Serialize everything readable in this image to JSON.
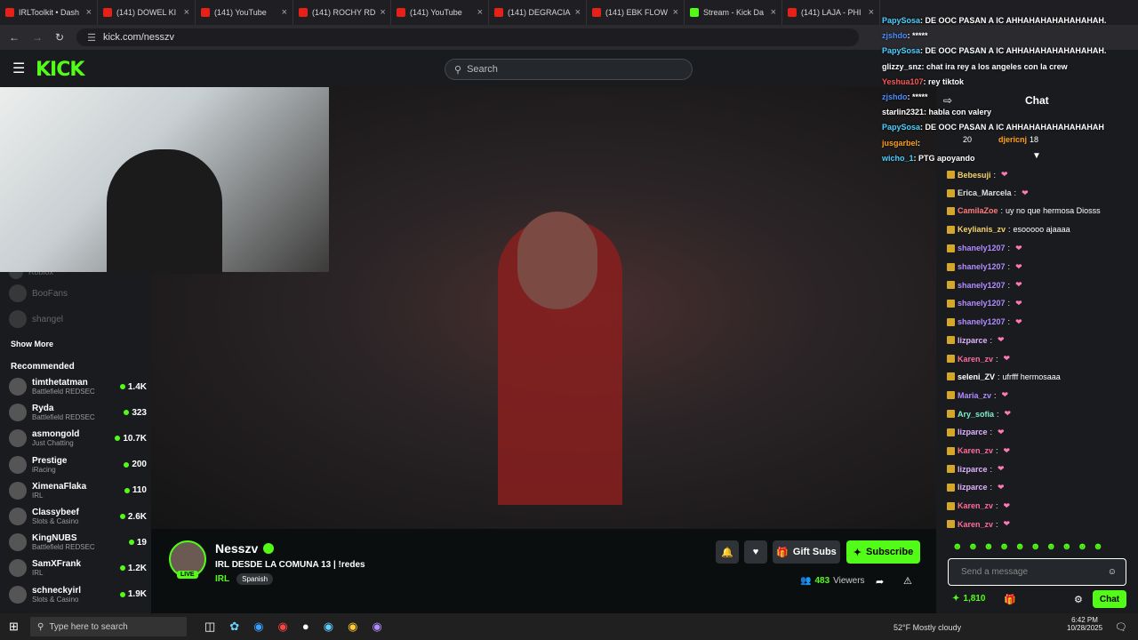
{
  "browser": {
    "tabs": [
      {
        "title": "IRLToolkit • Dash",
        "kind": "yt"
      },
      {
        "title": "(141) DOWEL KI",
        "kind": "yt"
      },
      {
        "title": "(141) YouTube",
        "kind": "yt"
      },
      {
        "title": "(141) ROCHY RD",
        "kind": "yt"
      },
      {
        "title": "(141) YouTube",
        "kind": "yt"
      },
      {
        "title": "(141) DEGRACIA",
        "kind": "yt"
      },
      {
        "title": "(141) EBK FLOW",
        "kind": "yt"
      },
      {
        "title": "Stream - Kick Da",
        "kind": "kick"
      },
      {
        "title": "(141) LAJA - PHI",
        "kind": "yt"
      }
    ],
    "url": "kick.com/nesszv"
  },
  "header": {
    "search_placeholder": "Search"
  },
  "sidebar": {
    "followed": [
      "Roblox",
      "BooFans",
      "shangel"
    ],
    "show_more": "Show More",
    "recommended_title": "Recommended",
    "recommended": [
      {
        "name": "timthetatman",
        "category": "Battlefield REDSEC",
        "viewers": "1.4K"
      },
      {
        "name": "Ryda",
        "category": "Battlefield REDSEC",
        "viewers": "323"
      },
      {
        "name": "asmongold",
        "category": "Just Chatting",
        "viewers": "10.7K"
      },
      {
        "name": "Prestige",
        "category": "iRacing",
        "viewers": "200"
      },
      {
        "name": "XimenaFlaka",
        "category": "IRL",
        "viewers": "110"
      },
      {
        "name": "Classybeef",
        "category": "Slots & Casino",
        "viewers": "2.6K"
      },
      {
        "name": "KingNUBS",
        "category": "Battlefield REDSEC",
        "viewers": "19"
      },
      {
        "name": "SamXFrank",
        "category": "IRL",
        "viewers": "1.2K"
      },
      {
        "name": "schneckyirl",
        "category": "Slots & Casino",
        "viewers": "1.9K"
      }
    ]
  },
  "stream": {
    "channel": "Nesszv",
    "title": "IRL DESDE LA COMUNA 13 | !redes",
    "category": "IRL",
    "language": "Spanish",
    "live_label": "LIVE",
    "viewers": "483",
    "viewers_label": "Viewers",
    "gift_label": "Gift Subs",
    "subscribe_label": "Subscribe"
  },
  "overlay_chat": [
    {
      "user": "PapySosa",
      "text": "DE OOC PASAN A IC AHHAHAHAHAHAHAHAH.",
      "color": "#4dd0ff"
    },
    {
      "user": "zjshdo",
      "text": "*****",
      "color": "#4d8cff"
    },
    {
      "user": "PapySosa",
      "text": "DE OOC PASAN A IC AHHAHAHAHAHAHAHAH.",
      "color": "#4dd0ff"
    },
    {
      "user": "glizzy_snz",
      "text": "chat ira rey a los angeles con la crew",
      "color": "#ffffff"
    },
    {
      "user": "Yeshua107",
      "text": "rey tiktok",
      "color": "#ff5555"
    },
    {
      "user": "zjshdo",
      "text": "*****",
      "color": "#4d8cff"
    },
    {
      "user": "starlin2321",
      "text": "habla con valery",
      "color": "#ffffff"
    },
    {
      "user": "PapySosa",
      "text": "DE OOC PASAN A IC AHHAHAHAHAHAHAHAH",
      "color": "#4dd0ff"
    },
    {
      "user": "jusgarbel",
      "text": "",
      "color": "#ff9f1a"
    },
    {
      "user": "wicho_1",
      "text": "PTG apoyando",
      "color": "#4dd0ff"
    }
  ],
  "chat": {
    "title": "Chat",
    "top_users": [
      {
        "name": "jusgarbel",
        "count": "20"
      },
      {
        "name": "djericnj",
        "count": "18"
      }
    ],
    "messages": [
      {
        "user": "Bebesuji",
        "text": "",
        "color": "#f5d36b"
      },
      {
        "user": "Erica_Marcela",
        "text": "",
        "color": "#e0e0e0"
      },
      {
        "user": "CamilaZoe",
        "text": "uy no que hermosa Diosss",
        "color": "#ff7a7a"
      },
      {
        "user": "Keylianis_zv",
        "text": "esooooo ajaaaa",
        "color": "#f5d36b"
      },
      {
        "user": "shanely1207",
        "text": "",
        "color": "#b18cff"
      },
      {
        "user": "shanely1207",
        "text": "",
        "color": "#b18cff"
      },
      {
        "user": "shanely1207",
        "text": "",
        "color": "#b18cff"
      },
      {
        "user": "shanely1207",
        "text": "",
        "color": "#b18cff"
      },
      {
        "user": "shanely1207",
        "text": "",
        "color": "#b18cff"
      },
      {
        "user": "lizparce",
        "text": "",
        "color": "#e0b3ff"
      },
      {
        "user": "Karen_zv",
        "text": "",
        "color": "#ff6b9a"
      },
      {
        "user": "seleni_ZV",
        "text": "ufrfff hermosaaa",
        "color": "#ffffff"
      },
      {
        "user": "Maria_zv",
        "text": "",
        "color": "#b18cff"
      },
      {
        "user": "Ary_sofia",
        "text": "",
        "color": "#7df0c8"
      },
      {
        "user": "lizparce",
        "text": "",
        "color": "#e0b3ff"
      },
      {
        "user": "Karen_zv",
        "text": "",
        "color": "#ff6b9a"
      },
      {
        "user": "lizparce",
        "text": "",
        "color": "#e0b3ff"
      },
      {
        "user": "lizparce",
        "text": "",
        "color": "#e0b3ff"
      },
      {
        "user": "Karen_zv",
        "text": "",
        "color": "#ff6b9a"
      },
      {
        "user": "Karen_zv",
        "text": "",
        "color": "#ff6b9a"
      }
    ],
    "input_placeholder": "Send a message",
    "points": "1,810",
    "send_label": "Chat"
  },
  "taskbar": {
    "search_placeholder": "Type here to search",
    "weather": "52°F  Mostly cloudy",
    "time": "6:42 PM",
    "date": "10/28/2025"
  },
  "colors": {
    "accent": "#53fc18",
    "bg": "#0b0e0f",
    "panel": "#191b1f"
  }
}
